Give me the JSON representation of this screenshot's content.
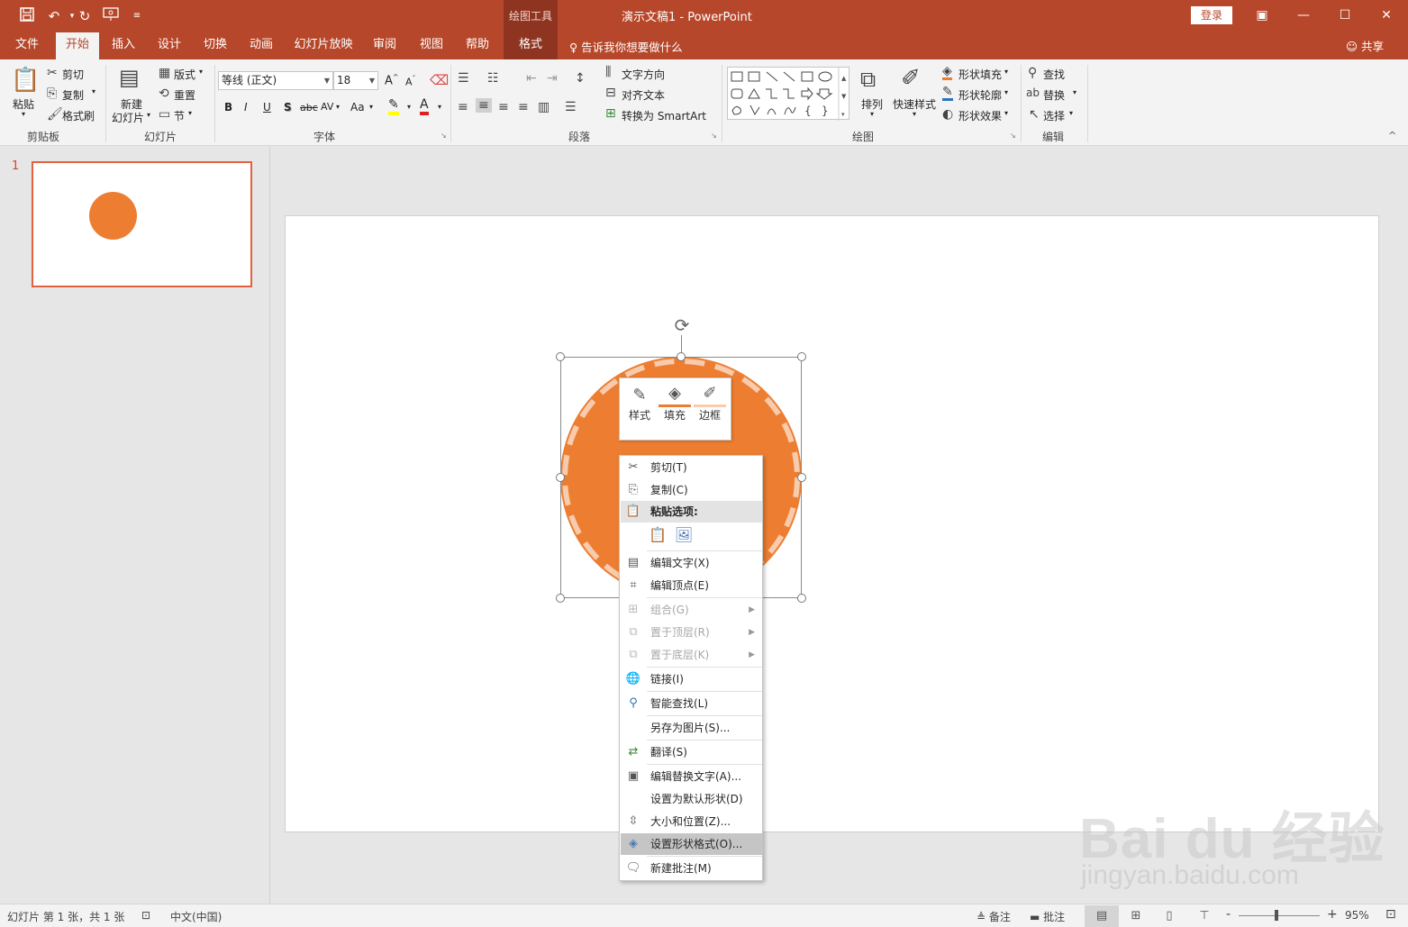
{
  "titlebar": {
    "doc_title": "演示文稿1  -  PowerPoint",
    "context_tool_group": "绘图工具",
    "login": "登录",
    "tell_me": "告诉我你想要做什么",
    "share": "共享"
  },
  "tabs": [
    "文件",
    "开始",
    "插入",
    "设计",
    "切换",
    "动画",
    "幻灯片放映",
    "审阅",
    "视图",
    "帮助",
    "格式"
  ],
  "ribbon": {
    "clipboard": {
      "paste": "粘贴",
      "cut": "剪切",
      "copy": "复制",
      "painter": "格式刷",
      "label": "剪贴板"
    },
    "slides": {
      "new_line1": "新建",
      "new_line2": "幻灯片",
      "layout": "版式",
      "reset": "重置",
      "section": "节",
      "label": "幻灯片"
    },
    "font": {
      "name": "等线 (正文)",
      "size": "18",
      "label": "字体",
      "buttons": [
        "B",
        "I",
        "U",
        "S",
        "abc",
        "AV",
        "Aa",
        "A"
      ]
    },
    "paragraph": {
      "text_dir": "文字方向",
      "align_text": "对齐文本",
      "smartart": "转换为 SmartArt",
      "label": "段落"
    },
    "drawing": {
      "arrange": "排列",
      "quick_styles": "快速样式",
      "fill": "形状填充",
      "outline": "形状轮廓",
      "effects": "形状效果",
      "label": "绘图"
    },
    "editing": {
      "find": "查找",
      "replace": "替换",
      "select": "选择",
      "label": "编辑"
    }
  },
  "thumbs": {
    "slide_number": "1"
  },
  "mini_toolbar": {
    "style": "样式",
    "fill": "填充",
    "border": "边框"
  },
  "context_menu": {
    "cut": "剪切(T)",
    "copy": "复制(C)",
    "paste_options": "粘贴选项:",
    "edit_text": "编辑文字(X)",
    "edit_points": "编辑顶点(E)",
    "group": "组合(G)",
    "bring_front": "置于顶层(R)",
    "send_back": "置于底层(K)",
    "link": "链接(I)",
    "smart_lookup": "智能查找(L)",
    "save_as_picture": "另存为图片(S)...",
    "translate": "翻译(S)",
    "edit_alt_text": "编辑替换文字(A)...",
    "set_default": "设置为默认形状(D)",
    "size_position": "大小和位置(Z)...",
    "format_shape": "设置形状格式(O)...",
    "new_comment": "新建批注(M)"
  },
  "status": {
    "slide_info": "幻灯片 第 1 张，共 1 张",
    "language": "中文(中国)",
    "notes": "备注",
    "comments": "批注",
    "zoom": "95%",
    "zoom_minus": "-",
    "zoom_plus": "+"
  },
  "watermark": {
    "brand": "Bai du 经验",
    "url": "jingyan.baidu.com"
  },
  "colors": {
    "accent": "#b7472a",
    "shape_fill": "#ed7d31",
    "selection_thumb": "#e5603f"
  }
}
